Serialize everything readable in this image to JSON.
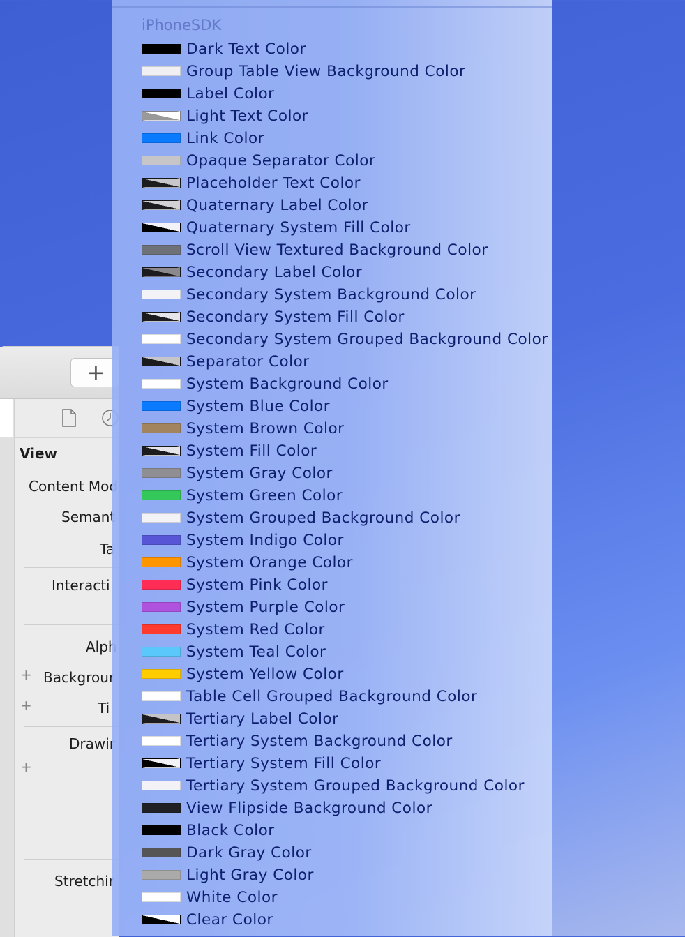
{
  "inspector": {
    "add_label": "+",
    "title": "View",
    "labels": [
      "Content Mod",
      "Semant",
      "Ta",
      "Interacti",
      "Alph",
      "Backgrour",
      "Ti",
      "Drawir",
      "Stretchir"
    ]
  },
  "menu": {
    "section_title": "iPhoneSDK",
    "items": [
      {
        "label": "Dark Text Color",
        "color": "#000000",
        "diag": null
      },
      {
        "label": "Group Table View Background Color",
        "color": "#efeff4",
        "diag": null
      },
      {
        "label": "Label Color",
        "color": "#000000",
        "diag": null
      },
      {
        "label": "Light Text Color",
        "color": "#999999",
        "diag": "#ffffff"
      },
      {
        "label": "Link Color",
        "color": "#0a7aff",
        "diag": null
      },
      {
        "label": "Opaque Separator Color",
        "color": "#c6c6c8",
        "diag": null
      },
      {
        "label": "Placeholder Text Color",
        "color": "#1c1c1e",
        "diag": "#c7c7cc"
      },
      {
        "label": "Quaternary Label Color",
        "color": "#1c1c1e",
        "diag": "#d1d1d6"
      },
      {
        "label": "Quaternary System Fill Color",
        "color": "#000000",
        "diag": "#f2f2f7"
      },
      {
        "label": "Scroll View Textured Background Color",
        "color": "#6f7179",
        "diag": null
      },
      {
        "label": "Secondary Label Color",
        "color": "#1c1c1e",
        "diag": "#8a8a8e"
      },
      {
        "label": "Secondary System Background Color",
        "color": "#f2f2f7",
        "diag": null
      },
      {
        "label": "Secondary System Fill Color",
        "color": "#1c1c1e",
        "diag": "#e5e5ea"
      },
      {
        "label": "Secondary System Grouped Background Color",
        "color": "#ffffff",
        "diag": null
      },
      {
        "label": "Separator Color",
        "color": "#1c1c1e",
        "diag": "#c6c6c8"
      },
      {
        "label": "System Background Color",
        "color": "#ffffff",
        "diag": null
      },
      {
        "label": "System Blue Color",
        "color": "#0a7aff",
        "diag": null
      },
      {
        "label": "System Brown Color",
        "color": "#a2845e",
        "diag": null
      },
      {
        "label": "System Fill Color",
        "color": "#1c1c1e",
        "diag": "#e5e5ea"
      },
      {
        "label": "System Gray Color",
        "color": "#8e8e93",
        "diag": null
      },
      {
        "label": "System Green Color",
        "color": "#34c759",
        "diag": null
      },
      {
        "label": "System Grouped Background Color",
        "color": "#f2f2f7",
        "diag": null
      },
      {
        "label": "System Indigo Color",
        "color": "#5856d6",
        "diag": null
      },
      {
        "label": "System Orange Color",
        "color": "#ff9500",
        "diag": null
      },
      {
        "label": "System Pink Color",
        "color": "#ff2d55",
        "diag": null
      },
      {
        "label": "System Purple Color",
        "color": "#af52de",
        "diag": null
      },
      {
        "label": "System Red Color",
        "color": "#ff3b30",
        "diag": null
      },
      {
        "label": "System Teal Color",
        "color": "#5ac8fa",
        "diag": null
      },
      {
        "label": "System Yellow Color",
        "color": "#ffcc00",
        "diag": null
      },
      {
        "label": "Table Cell Grouped Background Color",
        "color": "#ffffff",
        "diag": null
      },
      {
        "label": "Tertiary Label Color",
        "color": "#1c1c1e",
        "diag": "#c4c4c6"
      },
      {
        "label": "Tertiary System Background Color",
        "color": "#ffffff",
        "diag": null
      },
      {
        "label": "Tertiary System Fill Color",
        "color": "#000000",
        "diag": "#f2f2f7"
      },
      {
        "label": "Tertiary System Grouped Background Color",
        "color": "#f2f2f7",
        "diag": null
      },
      {
        "label": "View Flipside Background Color",
        "color": "#1f2124",
        "diag": null
      },
      {
        "label": "Black Color",
        "color": "#000000",
        "diag": null
      },
      {
        "label": "Dark Gray Color",
        "color": "#555555",
        "diag": null
      },
      {
        "label": "Light Gray Color",
        "color": "#aaaaaa",
        "diag": null
      },
      {
        "label": "White Color",
        "color": "#ffffff",
        "diag": null
      },
      {
        "label": "Clear Color",
        "color": "#000000",
        "diag": "#ffffff"
      }
    ]
  }
}
